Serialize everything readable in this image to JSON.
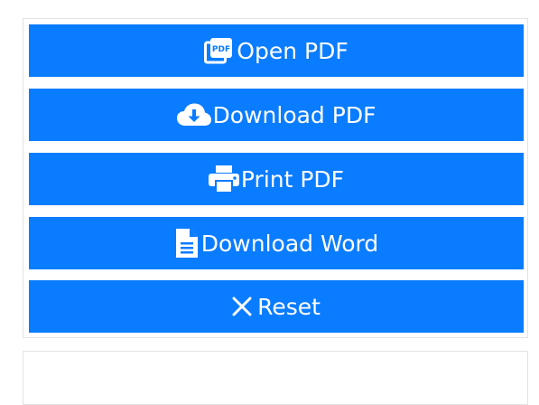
{
  "buttons": {
    "open_pdf": {
      "label": "Open PDF",
      "icon": "pdf-file-icon"
    },
    "download_pdf": {
      "label": "Download PDF",
      "icon": "cloud-download-icon"
    },
    "print_pdf": {
      "label": "Print PDF",
      "icon": "printer-icon"
    },
    "download_word": {
      "label": "Download Word",
      "icon": "document-icon"
    },
    "reset": {
      "label": "Reset",
      "icon": "close-icon"
    }
  },
  "colors": {
    "button_bg": "#0a7cff",
    "button_text": "#ffffff",
    "panel_border": "#e3e3e3"
  }
}
